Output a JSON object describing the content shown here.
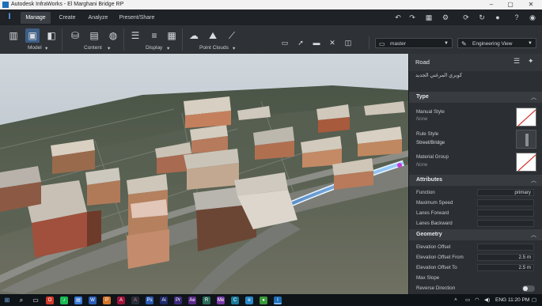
{
  "window": {
    "title": "Autodesk InfraWorks - El Marghani Bridge RP",
    "controls": [
      "minimize-icon",
      "maximize-icon",
      "close-icon"
    ]
  },
  "tabs": [
    "Manage",
    "Create",
    "Analyze",
    "Present/Share"
  ],
  "active_tab": "Manage",
  "quick_icons": [
    "undo-icon",
    "redo-icon",
    "settings-icon",
    "sync-icon",
    "user-icon",
    "help-icon",
    "account-icon"
  ],
  "ribbon": {
    "groups": [
      {
        "label": "Model",
        "icons": [
          "data-sources-icon",
          "model-properties-icon",
          "import-icon"
        ]
      },
      {
        "label": "Content",
        "icons": [
          "database-icon",
          "stacked-files-icon",
          "style-palette-icon"
        ]
      },
      {
        "label": "Display",
        "icons": [
          "layers-icon",
          "layers-alt-icon",
          "list-icon"
        ]
      },
      {
        "label": "Point Clouds",
        "icons": [
          "cloud-icon",
          "terrain-icon",
          "ruler-icon"
        ]
      }
    ],
    "tools": [
      "view-icon",
      "select-icon",
      "edit-icon",
      "measure-icon",
      "panel-icon"
    ],
    "branch_dropdown": "master",
    "view_dropdown": "Engineering View"
  },
  "panel": {
    "title": "Road",
    "subtitle": "كوبري المرغني الجديد",
    "sections": {
      "type": {
        "title": "Type",
        "manual_style_label": "Manual Style",
        "manual_style_value": "None",
        "rule_style_label": "Rule Style",
        "rule_style_value": "Street/Bridge",
        "material_group_label": "Material Group",
        "material_group_value": "None"
      },
      "attributes": {
        "title": "Attributes",
        "function_label": "Function",
        "function_value": "primary",
        "max_speed_label": "Maximum Speed",
        "max_speed_value": "",
        "lanes_forward_label": "Lanes Forward",
        "lanes_forward_value": "",
        "lanes_backward_label": "Lanes Backward",
        "lanes_backward_value": ""
      },
      "geometry": {
        "title": "Geometry",
        "elevation_offset_label": "Elevation Offset",
        "elevation_offset_value": "",
        "elevation_from_label": "Elevation Offset From",
        "elevation_from_value": "2.5 m",
        "elevation_to_label": "Elevation Offset To",
        "elevation_to_value": "2.5 m",
        "max_slope_label": "Max Slope",
        "reverse_direction_label": "Reverse Direction"
      }
    }
  },
  "taskbar": {
    "language": "ENG",
    "time": "11:20 PM"
  },
  "colors": {
    "accent": "#5aa0ff",
    "road_highlight": "#7fc8ff",
    "panel_bg": "#2b2e32"
  }
}
